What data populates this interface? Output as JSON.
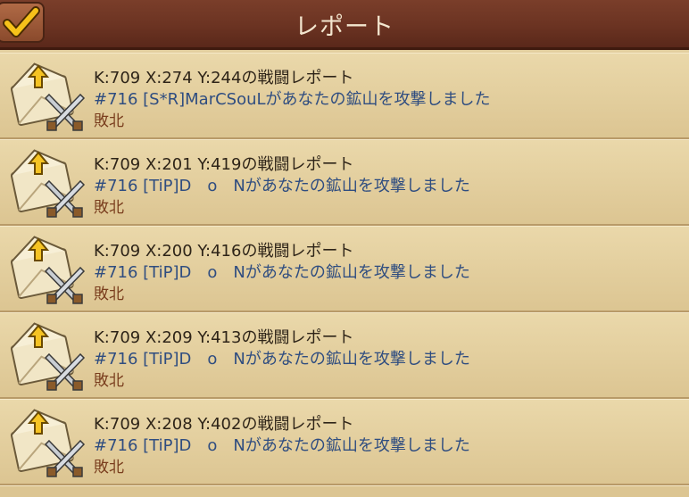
{
  "header": {
    "title": "レポート"
  },
  "reports": [
    {
      "title": "K:709 X:274 Y:244の戦闘レポート",
      "message": "#716 [S*R]MarCSouLがあなたの鉱山を攻撃しました",
      "result": "敗北"
    },
    {
      "title": "K:709 X:201 Y:419の戦闘レポート",
      "message": "#716 [TiP]D　o　Nがあなたの鉱山を攻撃しました",
      "result": "敗北"
    },
    {
      "title": "K:709 X:200 Y:416の戦闘レポート",
      "message": "#716 [TiP]D　o　Nがあなたの鉱山を攻撃しました",
      "result": "敗北"
    },
    {
      "title": "K:709 X:209 Y:413の戦闘レポート",
      "message": "#716 [TiP]D　o　Nがあなたの鉱山を攻撃しました",
      "result": "敗北"
    },
    {
      "title": "K:709 X:208 Y:402の戦闘レポート",
      "message": "#716 [TiP]D　o　Nがあなたの鉱山を攻撃しました",
      "result": "敗北"
    }
  ],
  "icons": {
    "report": "envelope-swords-icon",
    "select": "checkmark-icon"
  },
  "colors": {
    "header": "#6b3322",
    "row_bg": "#e3cf9f",
    "title_text": "#2e2418",
    "message_text": "#2f4d80",
    "result_text": "#7a3e1e"
  }
}
